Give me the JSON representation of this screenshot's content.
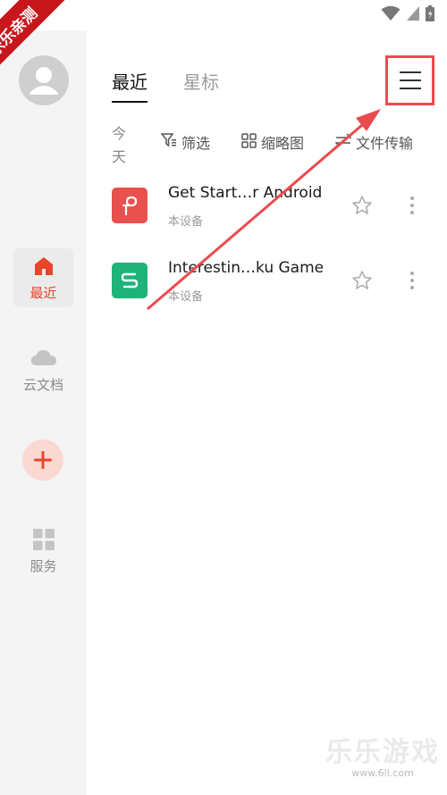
{
  "watermark": {
    "badge": "乐乐亲测",
    "brand": "乐乐游戏",
    "url": "www.6ll.com"
  },
  "sidebar": {
    "items": [
      {
        "label": "最近",
        "icon": "home-icon",
        "active": true
      },
      {
        "label": "云文档",
        "icon": "cloud-icon",
        "active": false
      },
      {
        "label": "",
        "icon": "plus-icon",
        "active": false
      },
      {
        "label": "服务",
        "icon": "grid-icon",
        "active": false
      }
    ]
  },
  "header": {
    "tabs": [
      {
        "label": "最近",
        "active": true
      },
      {
        "label": "星标",
        "active": false
      }
    ]
  },
  "toolbar": {
    "today": "今天",
    "filter": "筛选",
    "thumbnail": "缩略图",
    "transfer": "文件传输"
  },
  "files": [
    {
      "name": "Get Start…r Android",
      "location": "本设备",
      "type": "pdf",
      "color": "#e8514e"
    },
    {
      "name": "Interestin…ku Game",
      "location": "本设备",
      "type": "sheet",
      "color": "#1db37a"
    }
  ],
  "colors": {
    "accent": "#e8452c",
    "highlight": "#ea4b4f"
  }
}
